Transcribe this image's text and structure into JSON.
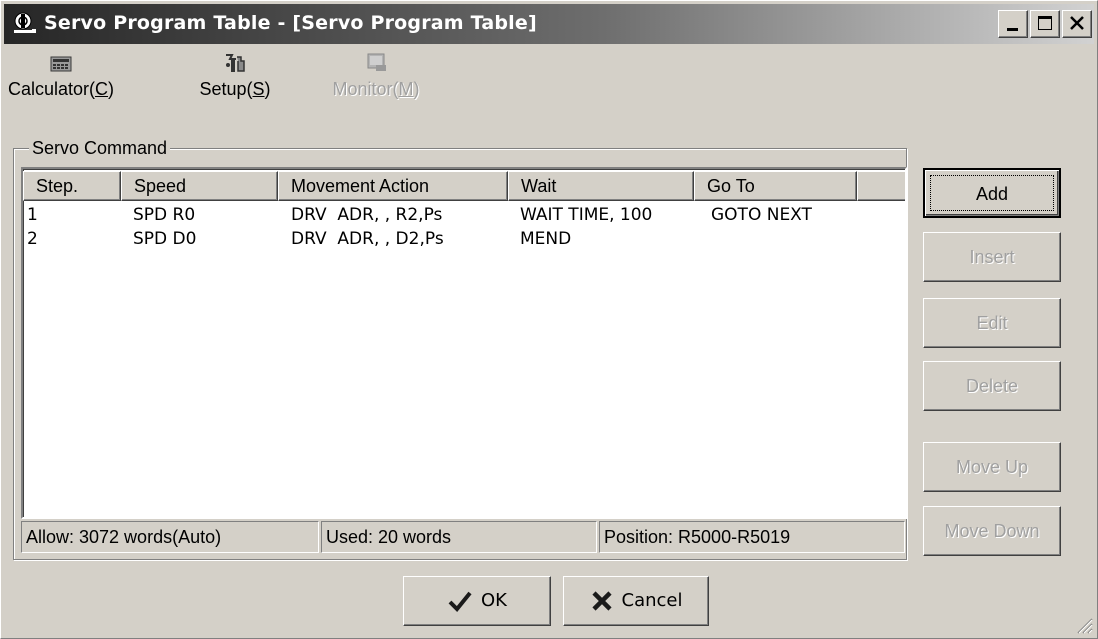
{
  "window": {
    "title": "Servo Program Table - [Servo Program Table]"
  },
  "toolbar": {
    "items": [
      {
        "label_pre": "Calculator(",
        "label_key": "C",
        "label_post": ")",
        "icon": "calculator-icon",
        "enabled": true
      },
      {
        "label_pre": "Setup(",
        "label_key": "S",
        "label_post": ")",
        "icon": "tools-icon",
        "enabled": true
      },
      {
        "label_pre": "Monitor(",
        "label_key": "M",
        "label_post": ")",
        "icon": "monitor-icon",
        "enabled": false
      }
    ]
  },
  "group": {
    "label": "Servo Command"
  },
  "table": {
    "columns": [
      "Step.",
      "Speed",
      "Movement Action",
      "Wait",
      "Go To"
    ],
    "rows": [
      [
        "1",
        "SPD R0",
        "DRV  ADR, , R2,Ps",
        "WAIT TIME, 100",
        "GOTO NEXT"
      ],
      [
        "2",
        "SPD D0",
        "DRV  ADR, , D2,Ps",
        "MEND",
        ""
      ]
    ]
  },
  "status": {
    "allow": "Allow: 3072 words(Auto)",
    "used": "Used: 20 words",
    "position": "Position: R5000-R5019"
  },
  "side_buttons": {
    "add": "Add",
    "insert": "Insert",
    "edit": "Edit",
    "delete": "Delete",
    "move_up": "Move Up",
    "move_down": "Move Down"
  },
  "dialog_buttons": {
    "ok": "OK",
    "cancel": "Cancel"
  },
  "colors": {
    "face": "#d4d0c8",
    "disabled_text": "#a0a0a0",
    "ok_check": "#1a1a1a"
  }
}
